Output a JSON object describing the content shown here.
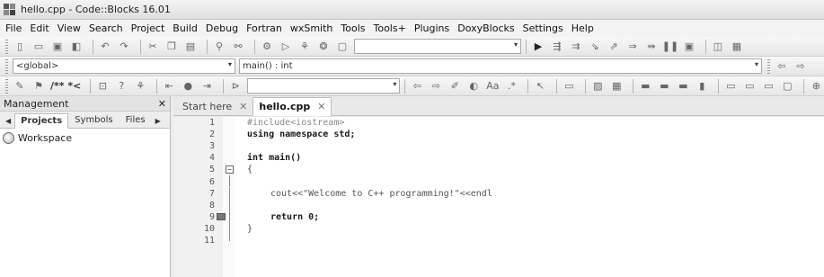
{
  "window": {
    "title": "hello.cpp - Code::Blocks 16.01"
  },
  "menu": [
    "File",
    "Edit",
    "View",
    "Search",
    "Project",
    "Build",
    "Debug",
    "Fortran",
    "wxSmith",
    "Tools",
    "Tools+",
    "Plugins",
    "DoxyBlocks",
    "Settings",
    "Help"
  ],
  "toolbar": {
    "scope_combo": "<global>",
    "function_combo": "main() : int",
    "comment_button": "/** *<"
  },
  "management": {
    "title": "Management",
    "close": "✕",
    "tabs": [
      "Projects",
      "Symbols",
      "Files"
    ],
    "tree": [
      "Workspace"
    ]
  },
  "editor": {
    "tabs": [
      {
        "label": "Start here",
        "close": "✕"
      },
      {
        "label": "hello.cpp",
        "close": "✕"
      }
    ],
    "lines": [
      {
        "n": "1",
        "text": "#include<iostream>"
      },
      {
        "n": "2",
        "text": "using namespace std;"
      },
      {
        "n": "3",
        "text": ""
      },
      {
        "n": "4",
        "text": "int main()"
      },
      {
        "n": "5",
        "text": "{"
      },
      {
        "n": "6",
        "text": ""
      },
      {
        "n": "7",
        "text": "cout<<\"Welcome to C++ programming!\"<<endl"
      },
      {
        "n": "8",
        "text": ""
      },
      {
        "n": "9",
        "text": "return 0;"
      },
      {
        "n": "10",
        "text": "}"
      },
      {
        "n": "11",
        "text": ""
      }
    ]
  }
}
